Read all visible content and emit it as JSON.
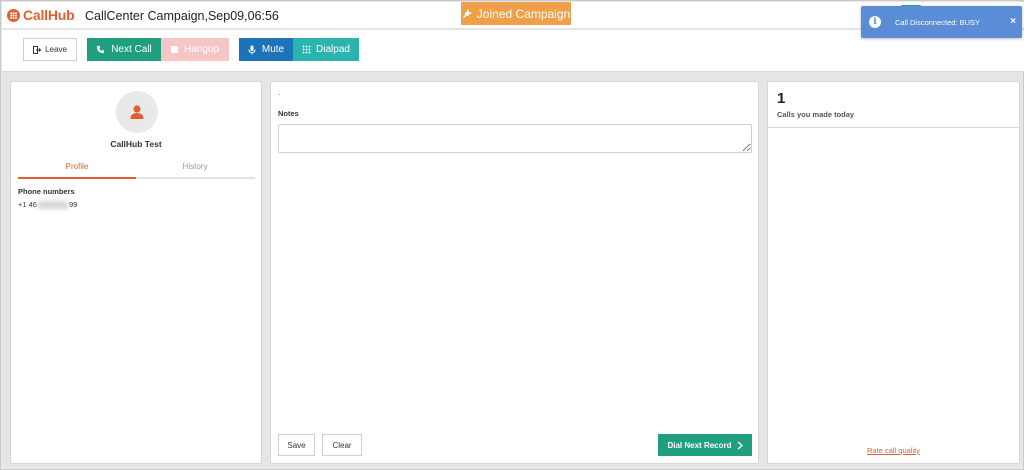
{
  "app": {
    "logo_text": "CallHub",
    "campaign_title": "CallCenter Campaign,Sep09,06:56",
    "joined_label": "Joined Campaign"
  },
  "toast": {
    "message": "Call Disconnected: BUSY",
    "close_glyph": "×",
    "icon": "info-icon",
    "color": "#5b8dd6"
  },
  "toolbar": {
    "leave_label": "Leave",
    "next_call_label": "Next Call",
    "hangup_label": "Hangup",
    "mute_label": "Mute",
    "dialpad_label": "Dialpad"
  },
  "contact": {
    "name": "CallHub Test",
    "tabs": [
      {
        "label": "Profile",
        "active": true
      },
      {
        "label": "History",
        "active": false
      }
    ],
    "phone_label": "Phone numbers",
    "phone_prefix": "+1 46",
    "phone_suffix": "99"
  },
  "notes": {
    "marker": ".",
    "label": "Notes",
    "value": "",
    "save_label": "Save",
    "clear_label": "Clear",
    "dial_next_label": "Dial Next Record"
  },
  "stats": {
    "calls_count": "1",
    "calls_label": "Calls you made today",
    "rate_link": "Rate call quality"
  },
  "colors": {
    "brand": "#e0612f",
    "green": "#1f9f7e",
    "blue": "#1e72b8",
    "teal": "#2bb3b0",
    "orange": "#f0a04b"
  }
}
